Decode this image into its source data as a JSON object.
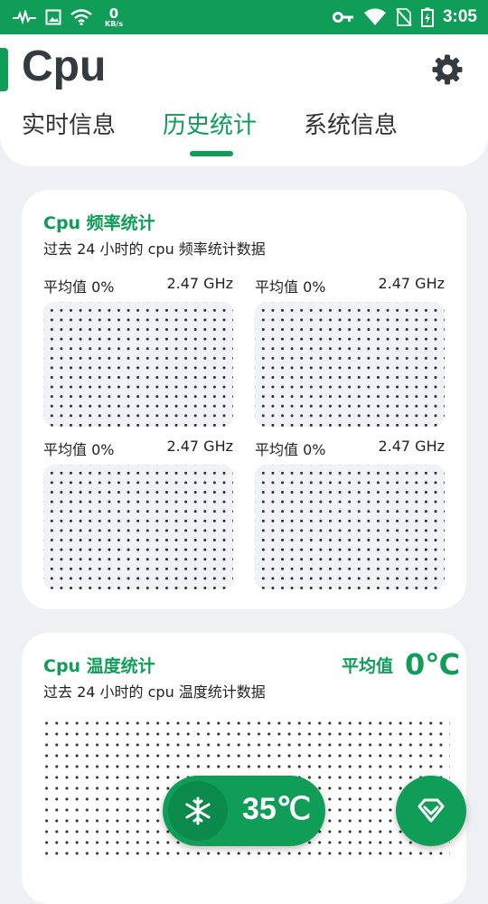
{
  "status_bar": {
    "net_speed_value": "0",
    "net_speed_unit": "KB/s",
    "time": "3:05"
  },
  "app": {
    "title": "Cpu"
  },
  "tabs": [
    {
      "label": "实时信息",
      "active": false
    },
    {
      "label": "历史统计",
      "active": true
    },
    {
      "label": "系统信息",
      "active": false
    }
  ],
  "freq_card": {
    "title": "Cpu 频率统计",
    "subtitle": "过去 24 小时的 cpu 频率统计数据",
    "cores": [
      {
        "avg_label": "平均值 0%",
        "freq": "2.47 GHz"
      },
      {
        "avg_label": "平均值 0%",
        "freq": "2.47 GHz"
      },
      {
        "avg_label": "平均值 0%",
        "freq": "2.47 GHz"
      },
      {
        "avg_label": "平均值 0%",
        "freq": "2.47 GHz"
      }
    ]
  },
  "temp_card": {
    "title": "Cpu 温度统计",
    "subtitle": "过去 24 小时的 cpu 温度统计数据",
    "avg_label": "平均值",
    "avg_value": "0℃"
  },
  "floating": {
    "current_temp": "35℃"
  },
  "colors": {
    "accent": "#0f9d58",
    "background": "#eef0f4"
  }
}
